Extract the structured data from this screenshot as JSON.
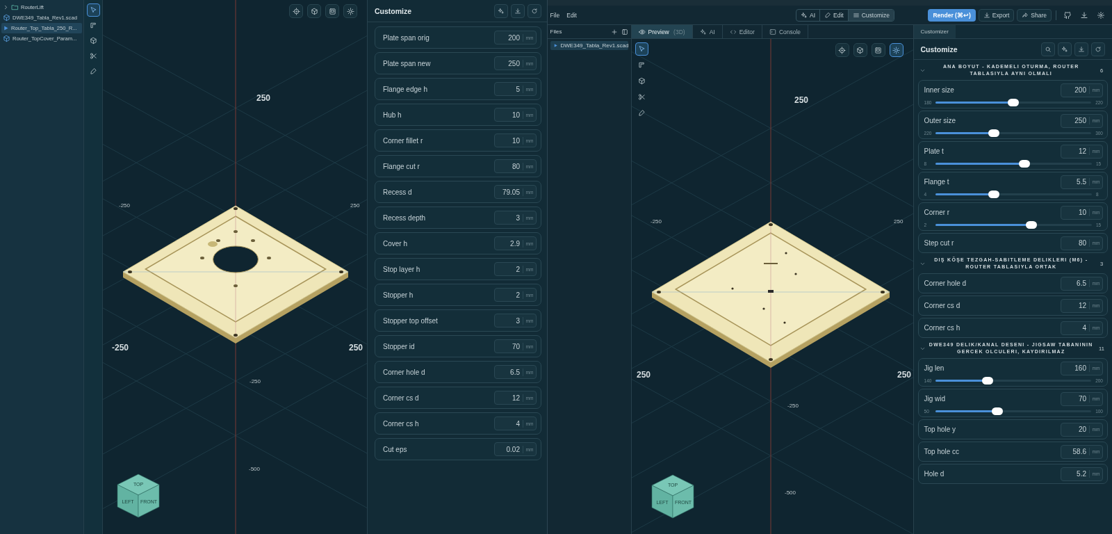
{
  "left_window": {
    "file_tree": [
      {
        "name": "RouterLift",
        "kind": "folder",
        "selected": false
      },
      {
        "name": "DWE349_Tabla_Rev1.scad",
        "kind": "model",
        "selected": false
      },
      {
        "name": "Router_Top_Tabla_250_R...",
        "kind": "model",
        "selected": true
      },
      {
        "name": "Router_TopCover_Param...",
        "kind": "model",
        "selected": false
      }
    ],
    "tools": [
      {
        "selected": true
      },
      {
        "selected": false
      },
      {
        "selected": false
      },
      {
        "selected": false
      },
      {
        "selected": false
      }
    ],
    "view_buttons": [
      {
        "selected": false
      },
      {
        "selected": false
      },
      {
        "selected": false
      },
      {
        "selected": false
      }
    ],
    "viewport": {
      "axis_labels": [
        "250",
        "-250",
        "250",
        "-250",
        "250",
        "-250",
        "-500"
      ],
      "view_cube": [
        "TOP",
        "LEFT",
        "FRONT"
      ]
    },
    "customize": {
      "title": "Customize",
      "params": [
        {
          "label": "Plate span orig",
          "value": "200",
          "unit": "mm"
        },
        {
          "label": "Plate span new",
          "value": "250",
          "unit": "mm"
        },
        {
          "label": "Flange edge h",
          "value": "5",
          "unit": "mm"
        },
        {
          "label": "Hub h",
          "value": "10",
          "unit": "mm"
        },
        {
          "label": "Corner fillet r",
          "value": "10",
          "unit": "mm"
        },
        {
          "label": "Flange cut r",
          "value": "80",
          "unit": "mm"
        },
        {
          "label": "Recess d",
          "value": "79.05",
          "unit": "mm"
        },
        {
          "label": "Recess depth",
          "value": "3",
          "unit": "mm"
        },
        {
          "label": "Cover h",
          "value": "2.9",
          "unit": "mm"
        },
        {
          "label": "Stop layer h",
          "value": "2",
          "unit": "mm"
        },
        {
          "label": "Stopper h",
          "value": "2",
          "unit": "mm"
        },
        {
          "label": "Stopper top offset",
          "value": "3",
          "unit": "mm"
        },
        {
          "label": "Stopper id",
          "value": "70",
          "unit": "mm"
        },
        {
          "label": "Corner hole d",
          "value": "6.5",
          "unit": "mm"
        },
        {
          "label": "Corner cs d",
          "value": "12",
          "unit": "mm"
        },
        {
          "label": "Corner cs h",
          "value": "4",
          "unit": "mm"
        },
        {
          "label": "Cut eps",
          "value": "0.02",
          "unit": "mm"
        }
      ]
    }
  },
  "right_window": {
    "menu": [
      "File",
      "Edit"
    ],
    "modes": [
      {
        "label": "AI",
        "selected": false
      },
      {
        "label": "Edit",
        "selected": false
      },
      {
        "label": "Customize",
        "selected": true
      }
    ],
    "render_button": "Render (⌘↩)",
    "actions": [
      "Export",
      "Share"
    ],
    "files": {
      "title": "Files",
      "items": [
        {
          "name": "DWE349_Tabla_Rev1.scad",
          "selected": true
        }
      ]
    },
    "tabs": [
      {
        "label": "Preview",
        "suffix": "(3D)",
        "selected": true
      },
      {
        "label": "AI",
        "selected": false
      },
      {
        "label": "Editor",
        "selected": false
      },
      {
        "label": "Console",
        "selected": false
      }
    ],
    "tools": [
      {
        "selected": true
      },
      {
        "selected": false
      },
      {
        "selected": false
      },
      {
        "selected": false
      },
      {
        "selected": false
      }
    ],
    "view_buttons": [
      {
        "selected": false
      },
      {
        "selected": false
      },
      {
        "selected": false
      },
      {
        "selected": true
      }
    ],
    "viewport": {
      "axis_labels": [
        "250",
        "-250",
        "250",
        "250",
        "250",
        "-250",
        "-500"
      ],
      "view_cube": [
        "TOP",
        "LEFT",
        "FRONT"
      ]
    },
    "customizer_tab": "Customizer",
    "customize": {
      "title": "Customize",
      "sections": [
        {
          "title": "ANA BOYUT - KADEMELI OTURMA, ROUTER TABLASIYLA AYNI OLMALI",
          "count": "6",
          "expanded": true,
          "params": [
            {
              "kind": "slider",
              "label": "Inner size",
              "value": "200",
              "unit": "mm",
              "min": "180",
              "max": "220",
              "level": 0.5
            },
            {
              "kind": "slider",
              "label": "Outer size",
              "value": "250",
              "unit": "mm",
              "min": "220",
              "max": "300",
              "level": 0.375
            },
            {
              "kind": "slider",
              "label": "Plate t",
              "value": "12",
              "unit": "mm",
              "min": "8",
              "max": "15",
              "level": 0.571
            },
            {
              "kind": "slider",
              "label": "Flange t",
              "value": "5.5",
              "unit": "mm",
              "min": "4",
              "max": "8",
              "level": 0.375
            },
            {
              "kind": "slider",
              "label": "Corner r",
              "value": "10",
              "unit": "mm",
              "min": "2",
              "max": "15",
              "level": 0.615
            },
            {
              "kind": "number",
              "label": "Step cut r",
              "value": "80",
              "unit": "mm"
            }
          ]
        },
        {
          "title": "DIŞ KÖŞE TEZGAH-SABITLEME DELIKLERI (M6) - ROUTER TABLASIYLA ORTAK",
          "count": "3",
          "expanded": true,
          "params": [
            {
              "kind": "number",
              "label": "Corner hole d",
              "value": "6.5",
              "unit": "mm"
            },
            {
              "kind": "number",
              "label": "Corner cs d",
              "value": "12",
              "unit": "mm"
            },
            {
              "kind": "number",
              "label": "Corner cs h",
              "value": "4",
              "unit": "mm"
            }
          ]
        },
        {
          "title": "DWE349 DELIK/KANAL DESENI - JIGSAW TABANININ GERCEK OLCULERI, KAYDIRILMAZ",
          "count": "11",
          "expanded": true,
          "params": [
            {
              "kind": "slider",
              "label": "Jig len",
              "value": "160",
              "unit": "mm",
              "min": "140",
              "max": "200",
              "level": 0.333
            },
            {
              "kind": "slider",
              "label": "Jig wid",
              "value": "70",
              "unit": "mm",
              "min": "50",
              "max": "100",
              "level": 0.4
            },
            {
              "kind": "number",
              "label": "Top hole y",
              "value": "20",
              "unit": "mm"
            },
            {
              "kind": "number",
              "label": "Top hole cc",
              "value": "58.6",
              "unit": "mm"
            },
            {
              "kind": "number",
              "label": "Hole d",
              "value": "5.2",
              "unit": "mm"
            }
          ]
        }
      ]
    }
  }
}
